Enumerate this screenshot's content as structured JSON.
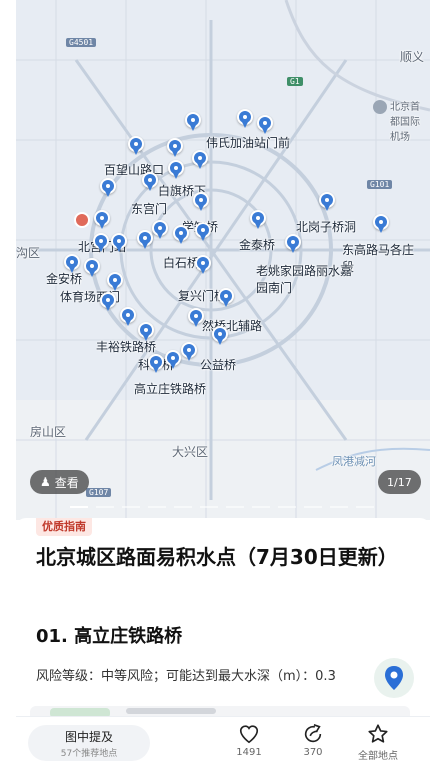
{
  "map": {
    "labels": {
      "shunyi": "顺义",
      "airport": "北京首都国际机场",
      "weishi": "伟氏加油站门前",
      "baiwangshan": "百望山路口",
      "baiqi": "白旗桥下",
      "donggongmen": "东宫门",
      "xuezhi": "学知桥",
      "beigang": "北岗子桥洞",
      "jintai": "金泰桥",
      "dongmaguo": "东高路马各庄段",
      "beigongmen": "北宫门站",
      "baishiqiao": "白石桥",
      "laoyao": "老姚家园路丽水嘉园南门",
      "jinanqiao": "金安桥",
      "tiyuchang": "体育场西门",
      "fuxingmen": "复兴门桥",
      "ranjiao": "然桥北辅路",
      "fengyu": "丰裕铁路桥",
      "keji": "科丰桥",
      "gongyi": "公益桥",
      "gaolizhuang": "高立庄铁路桥",
      "fangshan": "房山区",
      "daxing": "大兴区",
      "fenggang": "凤港减河",
      "gouzhu": "沟区"
    },
    "shields": [
      "G4501",
      "G1",
      "G101",
      "G107"
    ],
    "view_label": "查看",
    "counter": "1/17",
    "pin_color": "#3a7bd5"
  },
  "sheet": {
    "tag": "优质指南",
    "title": "北京城区路面易积水点（7月30日更新）",
    "subhead": "01. 高立庄铁路桥",
    "risk": "风险等级：中等风险；可能达到最大水深（m）：0.3"
  },
  "bottom": {
    "extract_label": "图中提及",
    "extract_sub": "57个推荐地点",
    "likes": "1491",
    "shares": "370",
    "all_label": "全部地点"
  }
}
